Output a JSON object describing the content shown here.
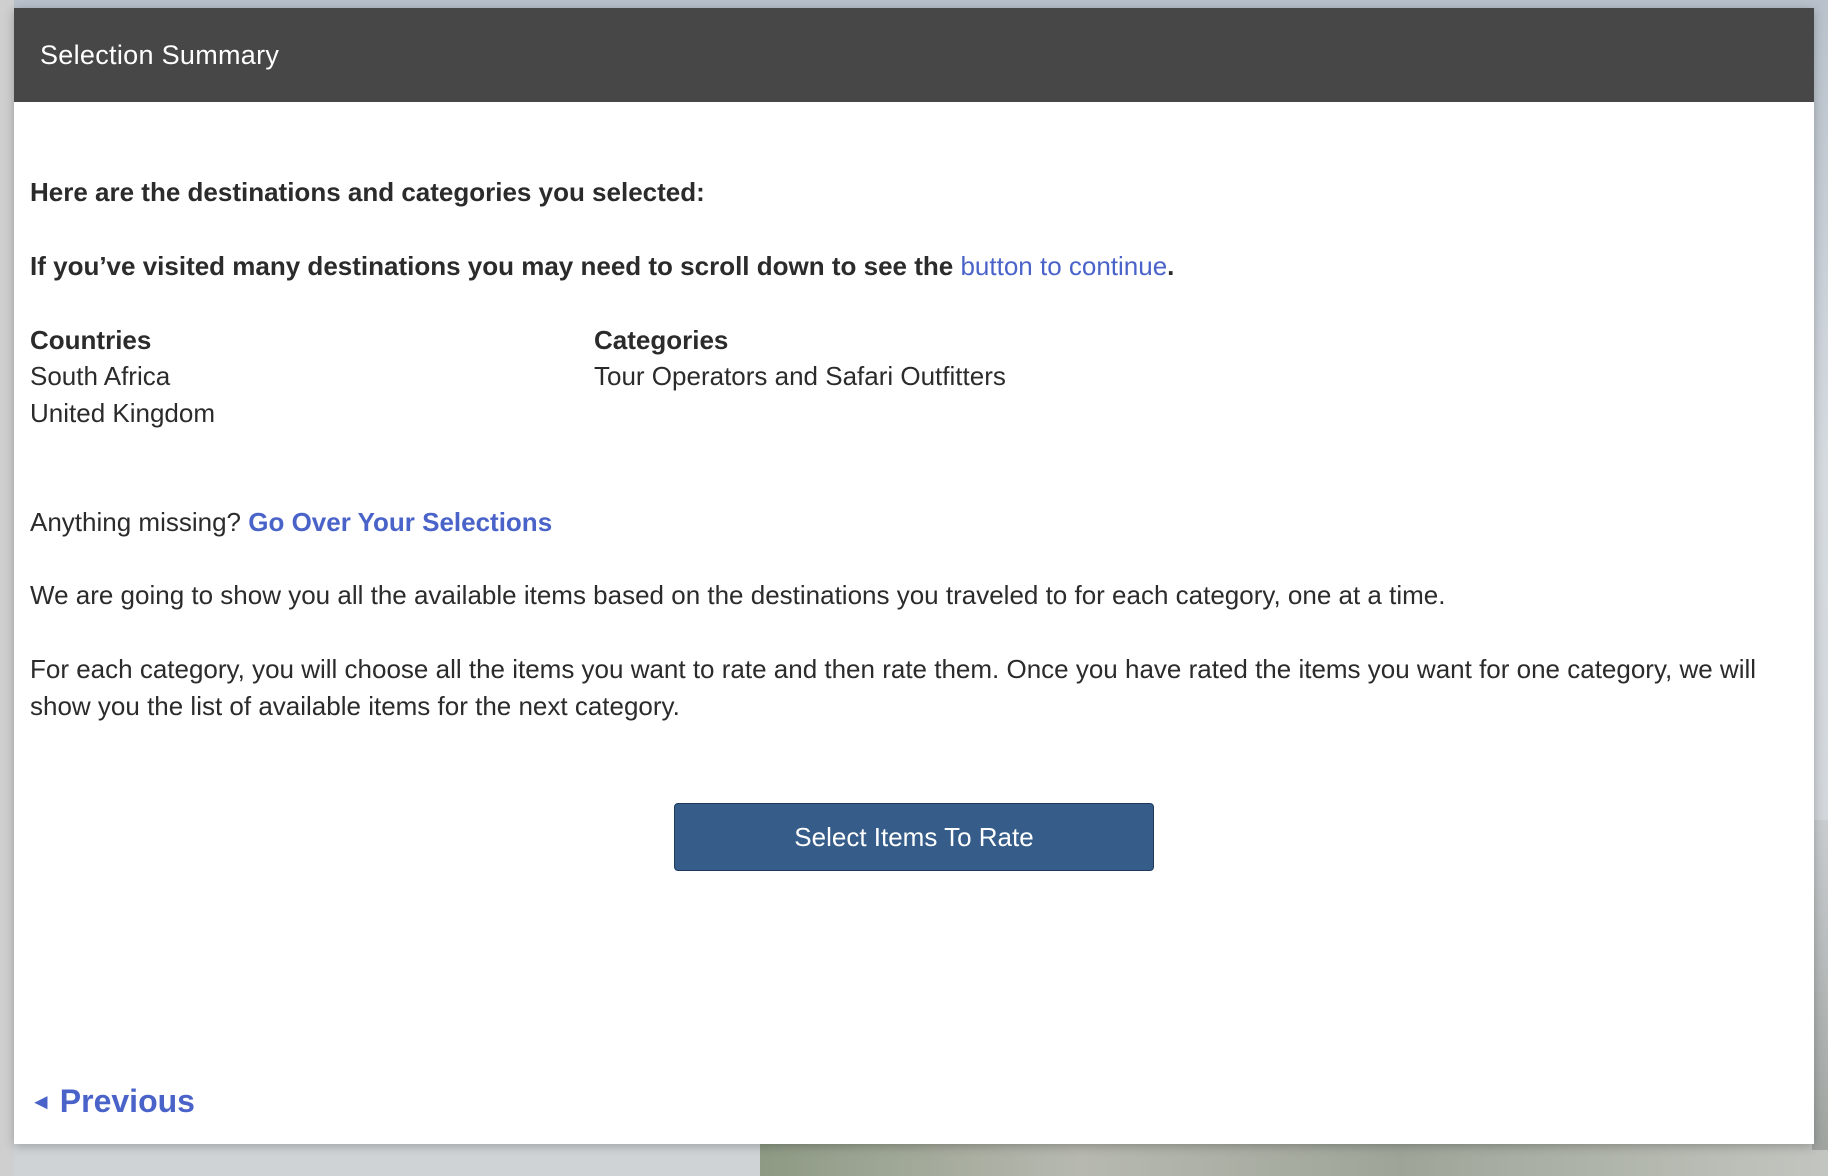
{
  "modal": {
    "title": "Selection Summary"
  },
  "summary": {
    "intro": "Here are the destinations and categories you selected:",
    "scroll_note_prefix": "If you’ve visited many destinations you may need to scroll down to see the ",
    "scroll_note_link": "button to continue",
    "scroll_note_suffix": "."
  },
  "countries": {
    "header": "Countries",
    "items": [
      "South Africa",
      "United Kingdom"
    ]
  },
  "categories": {
    "header": "Categories",
    "items": [
      "Tour Operators and Safari Outfitters"
    ]
  },
  "missing": {
    "prefix": "Anything missing? ",
    "link": "Go Over Your Selections"
  },
  "paragraphs": {
    "p1": "We are going to show you all the available items based on the destinations you traveled to for each category, one at a time.",
    "p2": "For each category, you will choose all the items you want to rate and then rate them. Once you have rated the items you want for one category, we will show you the list of available items for the next category."
  },
  "actions": {
    "primary_label": "Select Items To Rate",
    "previous_label": "Previous",
    "previous_icon": "◄"
  },
  "colors": {
    "header_bg": "#474747",
    "link": "#4a63c9",
    "primary_button": "#365d8a"
  }
}
